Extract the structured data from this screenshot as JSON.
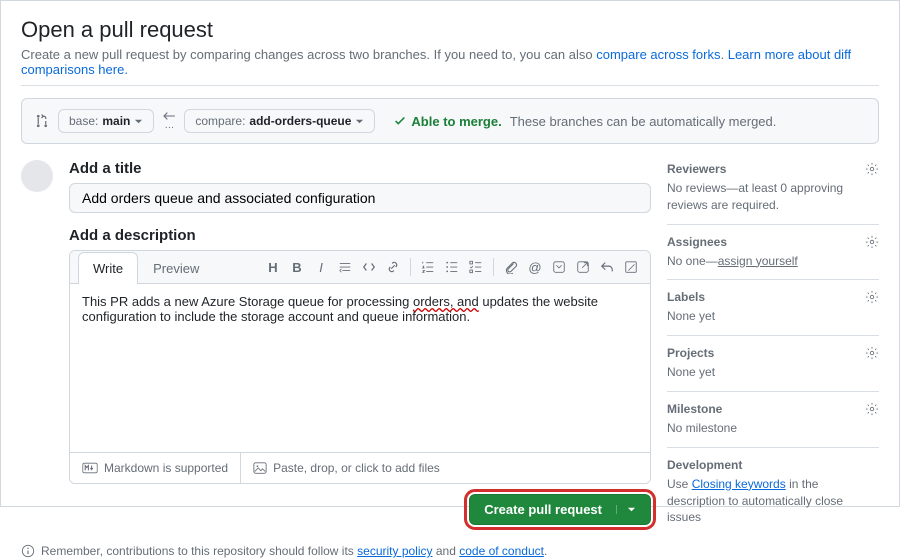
{
  "header": {
    "title": "Open a pull request",
    "subtitle_prefix": "Create a new pull request by comparing changes across two branches. If you need to, you can also ",
    "link_compare": "compare across forks",
    "subtitle_sep": ". ",
    "link_learn": "Learn more about diff comparisons here.",
    "subtitle_suffix": ""
  },
  "compare": {
    "base_label": "base:",
    "base_value": "main",
    "compare_label": "compare:",
    "compare_value": "add-orders-queue",
    "able_text": "Able to merge.",
    "able_desc": "These branches can be automatically merged."
  },
  "form": {
    "title_label": "Add a title",
    "title_value": "Add orders queue and associated configuration",
    "desc_label": "Add a description",
    "tab_write": "Write",
    "tab_preview": "Preview",
    "desc_pre": "This PR adds a new Azure Storage queue for processing ",
    "desc_ul": "orders, and",
    "desc_post": " updates the website configuration to include the storage account and queue information.",
    "footer_md": "Markdown is supported",
    "footer_attach": "Paste, drop, or click to add files",
    "submit": "Create pull request"
  },
  "footnote": {
    "prefix": "Remember, contributions to this repository should follow its ",
    "link1": "security policy",
    "mid": " and ",
    "link2": "code of conduct",
    "suffix": "."
  },
  "sidebar": {
    "reviewers": {
      "title": "Reviewers",
      "body": "No reviews—at least 0 approving reviews are required."
    },
    "assignees": {
      "title": "Assignees",
      "body_prefix": "No one—",
      "body_link": "assign yourself"
    },
    "labels": {
      "title": "Labels",
      "body": "None yet"
    },
    "projects": {
      "title": "Projects",
      "body": "None yet"
    },
    "milestone": {
      "title": "Milestone",
      "body": "No milestone"
    },
    "development": {
      "title": "Development",
      "body_prefix": "Use ",
      "body_link": "Closing keywords",
      "body_suffix": " in the description to automatically close issues"
    }
  }
}
